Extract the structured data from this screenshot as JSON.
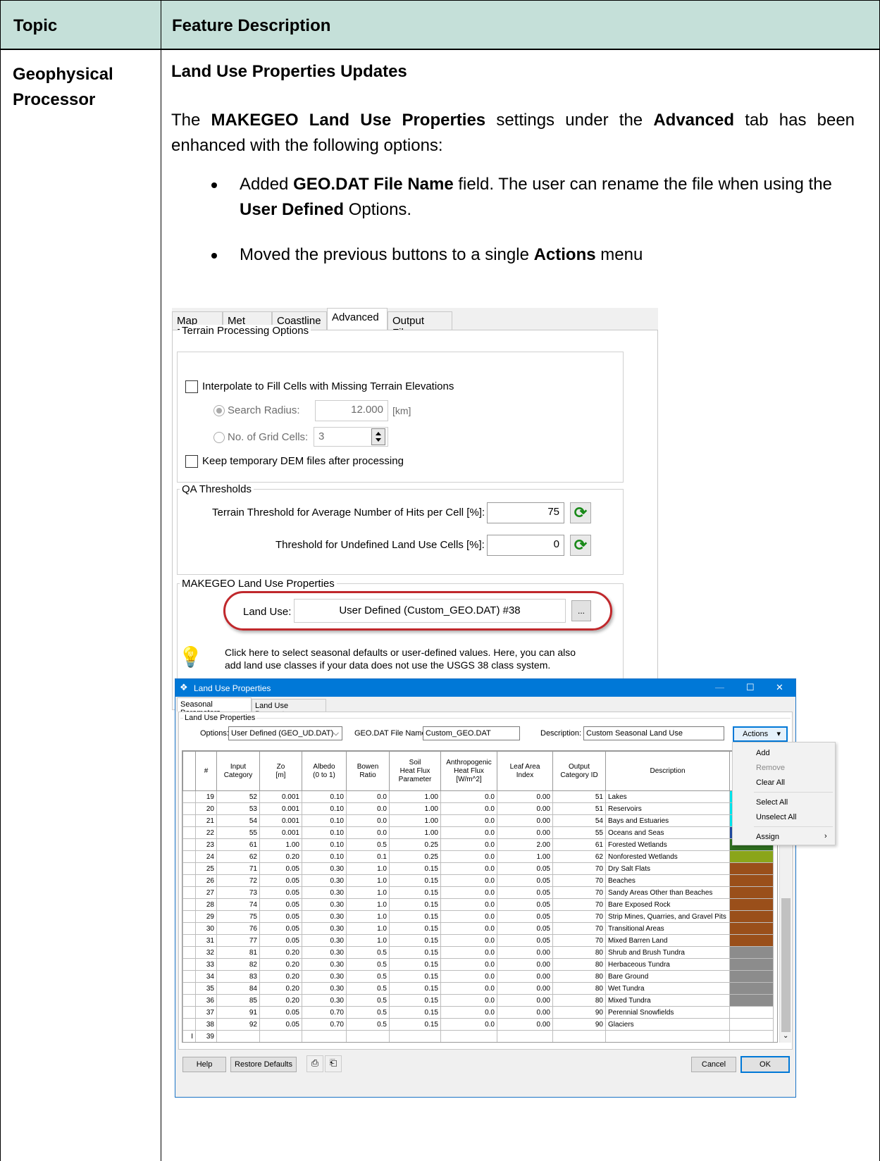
{
  "table": {
    "header_topic": "Topic",
    "header_feature": "Feature Description",
    "topic_line1": "Geophysical",
    "topic_line2": "Processor",
    "feature_title": "Land Use Properties Updates"
  },
  "paragraph": {
    "p1": "The ",
    "p2": "MAKEGEO Land Use Properties",
    "p3": " settings under the ",
    "p4": "Advanced",
    "p5": " tab has been enhanced with the following options:"
  },
  "bullets": [
    {
      "a": "Added ",
      "b": "GEO.DAT File Name",
      "c": " field. The user can rename the file when using the ",
      "d": "User Defined",
      "e": " Options."
    },
    {
      "a": "Moved the previous buttons to a single ",
      "b": "Actions",
      "c": " menu",
      "d": "",
      "e": ""
    }
  ],
  "shot1": {
    "tabs": [
      "Map Files",
      "Met Grid",
      "Coastline",
      "Advanced",
      "Output Files"
    ],
    "terrain_group": "Terrain Processing Options",
    "interpolate_label": "Interpolate to Fill Cells with Missing Terrain Elevations",
    "search_radius_label": "Search Radius:",
    "search_radius_value": "12.000",
    "search_radius_unit": "[km]",
    "grid_cells_label": "No. of Grid Cells:",
    "grid_cells_value": "3",
    "keep_dem_label": "Keep temporary DEM files after processing",
    "qa_group": "QA Thresholds",
    "terrain_threshold_label": "Terrain Threshold for Average Number of Hits per Cell [%]:",
    "terrain_threshold_value": "75",
    "undefined_threshold_label": "Threshold for Undefined Land Use Cells [%]:",
    "undefined_threshold_value": "0",
    "makegeo_group": "MAKEGEO Land Use Properties",
    "land_use_label": "Land Use:",
    "land_use_value": "User Defined (Custom_GEO.DAT)  #38",
    "browse_label": "...",
    "hint_line1": "Click here to select seasonal defaults or user-defined values.  Here, you can also",
    "hint_line2": "add land use classes if your data does not use the USGS 38 class system."
  },
  "dialog": {
    "title": "Land Use Properties",
    "tabs": [
      "Seasonal Parameters",
      "Land Use Parameters"
    ],
    "group": "Land Use Properties",
    "options_label": "Options:",
    "options_value": "User Defined (GEO_UD.DAT)",
    "geodat_label": "GEO.DAT File Name:",
    "geodat_value": "Custom_GEO.DAT",
    "description_label": "Description:",
    "description_value": "Custom Seasonal Land Use",
    "actions_label": "Actions",
    "columns": [
      "#",
      "Input\nCategory",
      "Zo\n[m]",
      "Albedo\n(0 to 1)",
      "Bowen\nRatio",
      "Soil\nHeat Flux\nParameter",
      "Anthropogenic\nHeat Flux\n[W/m^2]",
      "Leaf Area\nIndex",
      "Output\nCategory ID",
      "Description"
    ],
    "rows": [
      {
        "n": "19",
        "cat": "52",
        "zo": "0.001",
        "alb": "0.10",
        "bow": "0.0",
        "soil": "1.00",
        "anth": "0.0",
        "lai": "0.00",
        "out": "51",
        "desc": "Lakes",
        "color": "#00e5ee"
      },
      {
        "n": "20",
        "cat": "53",
        "zo": "0.001",
        "alb": "0.10",
        "bow": "0.0",
        "soil": "1.00",
        "anth": "0.0",
        "lai": "0.00",
        "out": "51",
        "desc": "Reservoirs",
        "color": "#00e5ee"
      },
      {
        "n": "21",
        "cat": "54",
        "zo": "0.001",
        "alb": "0.10",
        "bow": "0.0",
        "soil": "1.00",
        "anth": "0.0",
        "lai": "0.00",
        "out": "54",
        "desc": "Bays and Estuaries",
        "color": "#00e5ee"
      },
      {
        "n": "22",
        "cat": "55",
        "zo": "0.001",
        "alb": "0.10",
        "bow": "0.0",
        "soil": "1.00",
        "anth": "0.0",
        "lai": "0.00",
        "out": "55",
        "desc": "Oceans and Seas",
        "color": "#1f4aa0"
      },
      {
        "n": "23",
        "cat": "61",
        "zo": "1.00",
        "alb": "0.10",
        "bow": "0.5",
        "soil": "0.25",
        "anth": "0.0",
        "lai": "2.00",
        "out": "61",
        "desc": "Forested Wetlands",
        "color": "#2e6e1f"
      },
      {
        "n": "24",
        "cat": "62",
        "zo": "0.20",
        "alb": "0.10",
        "bow": "0.1",
        "soil": "0.25",
        "anth": "0.0",
        "lai": "1.00",
        "out": "62",
        "desc": "Nonforested Wetlands",
        "color": "#8aa51a"
      },
      {
        "n": "25",
        "cat": "71",
        "zo": "0.05",
        "alb": "0.30",
        "bow": "1.0",
        "soil": "0.15",
        "anth": "0.0",
        "lai": "0.05",
        "out": "70",
        "desc": "Dry Salt Flats",
        "color": "#9a4f1a"
      },
      {
        "n": "26",
        "cat": "72",
        "zo": "0.05",
        "alb": "0.30",
        "bow": "1.0",
        "soil": "0.15",
        "anth": "0.0",
        "lai": "0.05",
        "out": "70",
        "desc": "Beaches",
        "color": "#9a4f1a"
      },
      {
        "n": "27",
        "cat": "73",
        "zo": "0.05",
        "alb": "0.30",
        "bow": "1.0",
        "soil": "0.15",
        "anth": "0.0",
        "lai": "0.05",
        "out": "70",
        "desc": "Sandy Areas Other than Beaches",
        "color": "#9a4f1a"
      },
      {
        "n": "28",
        "cat": "74",
        "zo": "0.05",
        "alb": "0.30",
        "bow": "1.0",
        "soil": "0.15",
        "anth": "0.0",
        "lai": "0.05",
        "out": "70",
        "desc": "Bare Exposed Rock",
        "color": "#9a4f1a"
      },
      {
        "n": "29",
        "cat": "75",
        "zo": "0.05",
        "alb": "0.30",
        "bow": "1.0",
        "soil": "0.15",
        "anth": "0.0",
        "lai": "0.05",
        "out": "70",
        "desc": "Strip Mines, Quarries, and Gravel Pits",
        "color": "#9a4f1a"
      },
      {
        "n": "30",
        "cat": "76",
        "zo": "0.05",
        "alb": "0.30",
        "bow": "1.0",
        "soil": "0.15",
        "anth": "0.0",
        "lai": "0.05",
        "out": "70",
        "desc": "Transitional Areas",
        "color": "#9a4f1a"
      },
      {
        "n": "31",
        "cat": "77",
        "zo": "0.05",
        "alb": "0.30",
        "bow": "1.0",
        "soil": "0.15",
        "anth": "0.0",
        "lai": "0.05",
        "out": "70",
        "desc": "Mixed Barren Land",
        "color": "#9a4f1a"
      },
      {
        "n": "32",
        "cat": "81",
        "zo": "0.20",
        "alb": "0.30",
        "bow": "0.5",
        "soil": "0.15",
        "anth": "0.0",
        "lai": "0.00",
        "out": "80",
        "desc": "Shrub and Brush Tundra",
        "color": "#8c8c8c"
      },
      {
        "n": "33",
        "cat": "82",
        "zo": "0.20",
        "alb": "0.30",
        "bow": "0.5",
        "soil": "0.15",
        "anth": "0.0",
        "lai": "0.00",
        "out": "80",
        "desc": "Herbaceous Tundra",
        "color": "#8c8c8c"
      },
      {
        "n": "34",
        "cat": "83",
        "zo": "0.20",
        "alb": "0.30",
        "bow": "0.5",
        "soil": "0.15",
        "anth": "0.0",
        "lai": "0.00",
        "out": "80",
        "desc": "Bare Ground",
        "color": "#8c8c8c"
      },
      {
        "n": "35",
        "cat": "84",
        "zo": "0.20",
        "alb": "0.30",
        "bow": "0.5",
        "soil": "0.15",
        "anth": "0.0",
        "lai": "0.00",
        "out": "80",
        "desc": "Wet Tundra",
        "color": "#8c8c8c"
      },
      {
        "n": "36",
        "cat": "85",
        "zo": "0.20",
        "alb": "0.30",
        "bow": "0.5",
        "soil": "0.15",
        "anth": "0.0",
        "lai": "0.00",
        "out": "80",
        "desc": "Mixed Tundra",
        "color": "#8c8c8c"
      },
      {
        "n": "37",
        "cat": "91",
        "zo": "0.05",
        "alb": "0.70",
        "bow": "0.5",
        "soil": "0.15",
        "anth": "0.0",
        "lai": "0.00",
        "out": "90",
        "desc": "Perennial Snowfields",
        "color": "#ffffff"
      },
      {
        "n": "38",
        "cat": "92",
        "zo": "0.05",
        "alb": "0.70",
        "bow": "0.5",
        "soil": "0.15",
        "anth": "0.0",
        "lai": "0.00",
        "out": "90",
        "desc": "Glaciers",
        "color": "#ffffff"
      },
      {
        "n": "39",
        "cat": "",
        "zo": "",
        "alb": "",
        "bow": "",
        "soil": "",
        "anth": "",
        "lai": "",
        "out": "",
        "desc": "",
        "color": "#ffffff"
      }
    ],
    "help_label": "Help",
    "restore_label": "Restore Defaults",
    "cancel_label": "Cancel",
    "ok_label": "OK",
    "menu": {
      "add": "Add",
      "remove": "Remove",
      "clear_all": "Clear All",
      "select_all": "Select All",
      "unselect_all": "Unselect All",
      "assign": "Assign"
    }
  }
}
